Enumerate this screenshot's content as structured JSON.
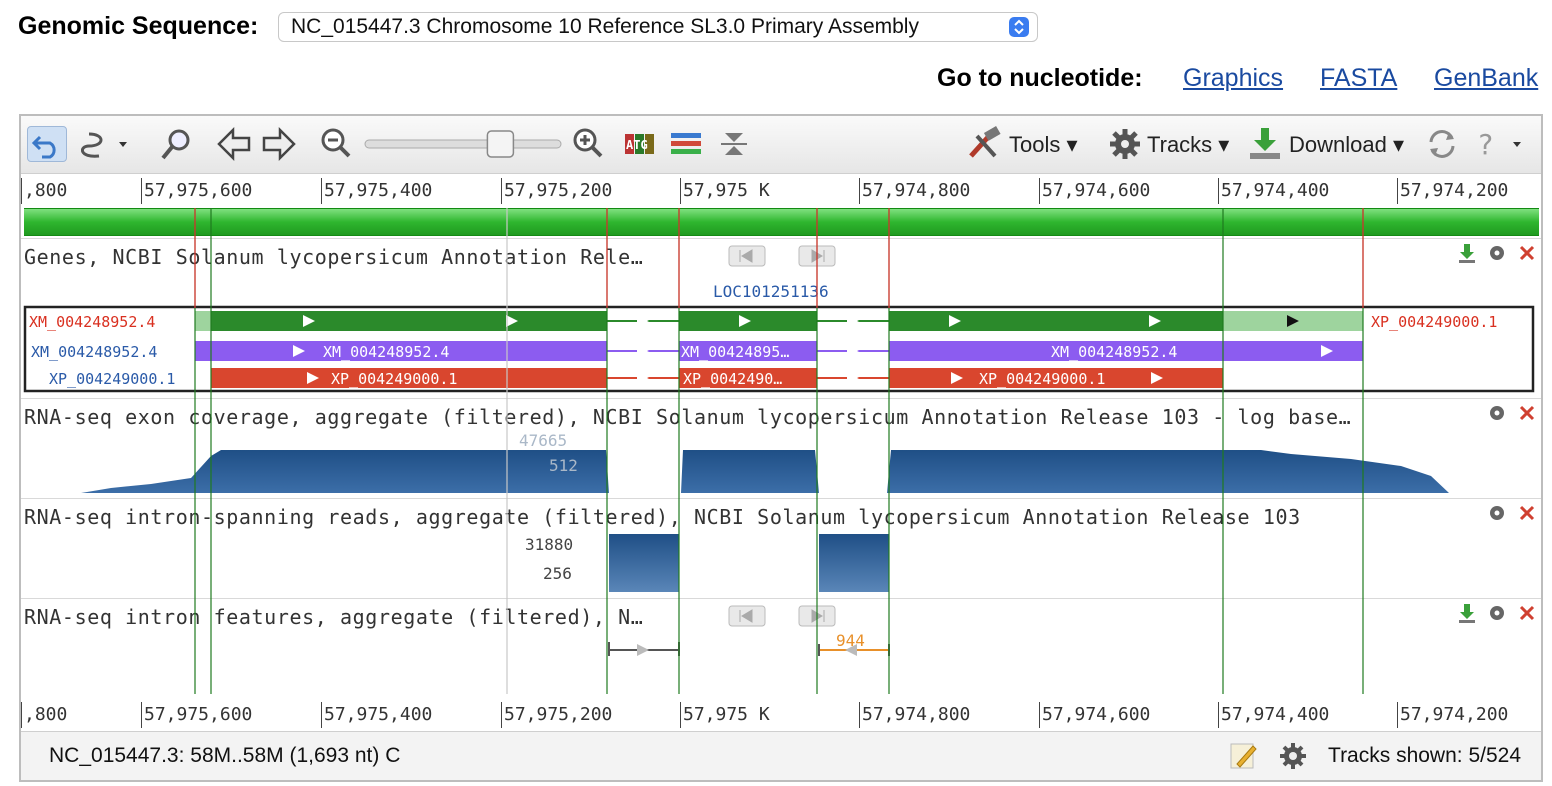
{
  "header": {
    "genomic_label": "Genomic Sequence:",
    "sequence_value": "NC_015447.3 Chromosome 10 Reference SL3.0 Primary Assembly",
    "goto_label": "Go to nucleotide:",
    "links": [
      "Graphics",
      "FASTA",
      "GenBank"
    ]
  },
  "toolbar": {
    "tools_label": "Tools",
    "tracks_label": "Tracks",
    "download_label": "Download",
    "zoom_level": 0.72
  },
  "ruler": {
    "ticks": [
      ",800",
      "57,975,600",
      "57,975,400",
      "57,975,200",
      "57,975 K",
      "57,974,800",
      "57,974,600",
      "57,974,400",
      "57,974,200"
    ]
  },
  "tracks": {
    "genes_title": "Genes, NCBI Solanum lycopersicum Annotation Rele…",
    "gene_name": "LOC101251136",
    "rows": {
      "r1_left": "XM_004248952.4",
      "r1_right": "XP_004249000.1",
      "r2_left": "XM_004248952.4",
      "r3_left": "XP_004249000.1",
      "r2_seg1": "XM_004248952.4",
      "r2_seg2": "XM_00424895…",
      "r2_seg3": "XM_004248952.4",
      "r3_seg1": "XP_004249000.1",
      "r3_seg2": "XP_0042490…",
      "r3_seg3": "XP_004249000.1"
    },
    "exon_title": "RNA-seq exon coverage, aggregate (filtered), NCBI Solanum lycopersicum Annotation Release 103 - log base…",
    "exon_max": "47665",
    "exon_mid": "512",
    "intron_reads_title": "RNA-seq intron-spanning reads, aggregate (filtered), NCBI Solanum lycopersicum Annotation Release 103",
    "intron_max": "31880",
    "intron_mid": "256",
    "intron_feat_title": "RNA-seq intron features, aggregate (filtered), N…",
    "intron_feat_count": "944"
  },
  "status": {
    "location": "NC_015447.3: 58M..58M (1,693 nt) C",
    "tracks_shown": "Tracks shown: 5/524"
  },
  "colors": {
    "genes_green": "#2b8a2b",
    "mrna_purple": "#8c5cf0",
    "cds_red": "#d9462e",
    "coverage_blue": "#1f4f86"
  }
}
